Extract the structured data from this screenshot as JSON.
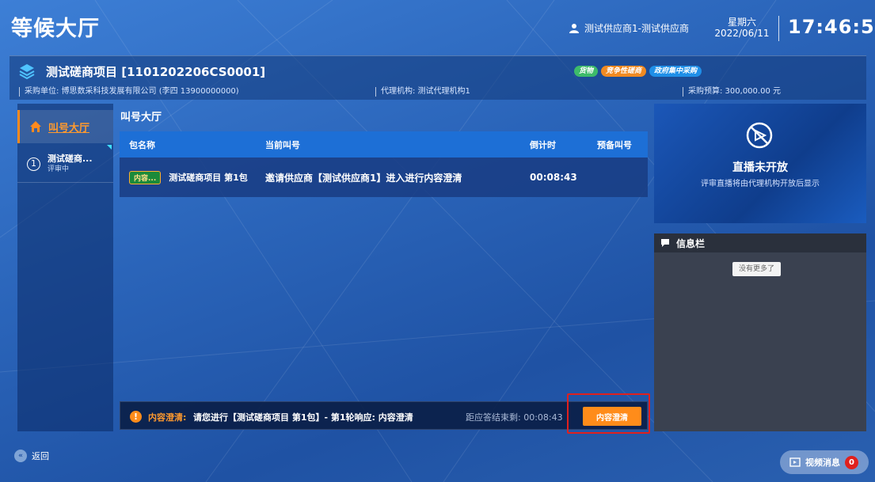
{
  "header": {
    "app_title": "等候大厅",
    "user": "测试供应商1-测试供应商",
    "weekday": "星期六",
    "date": "2022/06/11",
    "time": "17:46:51"
  },
  "project": {
    "title": "测试磋商项目 [1101202206CS0001]",
    "tags": [
      "货物",
      "竞争性磋商",
      "政府集中采购"
    ],
    "purchaser": "采购单位: 博思数采科技发展有限公司 (李四 13900000000)",
    "agency": "代理机构: 测试代理机构1",
    "budget": "采购预算: 300,000.00 元"
  },
  "nav": {
    "hall_label": "叫号大厅",
    "package_num": "1",
    "package_name": "测试磋商...",
    "package_status": "评审中"
  },
  "hall": {
    "title": "叫号大厅",
    "columns": [
      "包名称",
      "当前叫号",
      "倒计时",
      "预备叫号"
    ],
    "rows": [
      {
        "status_pill": "内容...",
        "package": "测试磋商项目 第1包",
        "current_call": "邀请供应商【测试供应商1】进入进行内容澄清",
        "countdown": "00:08:43",
        "next_call": ""
      }
    ]
  },
  "alert": {
    "label": "内容澄清:",
    "text": "请您进行【测试磋商项目 第1包】- 第1轮响应: 内容澄清",
    "remaining": "距应答结束剩: 00:08:43",
    "button": "内容澄清"
  },
  "live": {
    "title": "直播未开放",
    "subtitle": "评审直播将由代理机构开放后显示"
  },
  "info": {
    "title": "信息栏",
    "no_more": "没有更多了"
  },
  "footer": {
    "back": "返回",
    "video_msg": "视频消息",
    "video_count": "0"
  },
  "colors": {
    "accent_orange": "#ff8c1a",
    "highlight_red": "#e0201d",
    "header_blue": "#1d6fd6"
  }
}
